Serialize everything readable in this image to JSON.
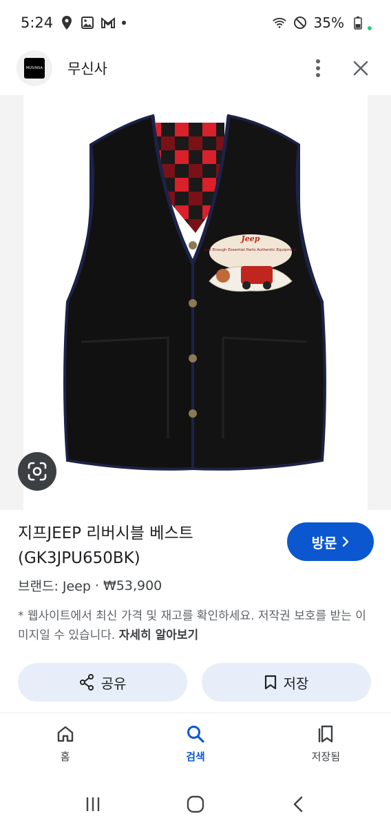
{
  "status_bar": {
    "time": "5:24",
    "battery": "35%",
    "icons": [
      "location-icon",
      "image-icon",
      "gmail-icon",
      "more-dot-icon",
      "wifi-icon",
      "do-not-disturb-icon",
      "battery-icon"
    ]
  },
  "app_bar": {
    "logo_text": "MUSINSA",
    "site_name": "무신사",
    "menu_icon": "more-vert-icon",
    "close_icon": "close-icon"
  },
  "product": {
    "title": "지프JEEP 리버시블 베스트 (GK3JPU650BK)",
    "brand_line": "브랜드: Jeep",
    "separator": "·",
    "price": "₩53,900",
    "visit_label": "방문",
    "visit_icon": "chevron-right-icon",
    "patch_text": "Jeep",
    "patch_sub": "Just Enough Essential Parts Authentic Equipment"
  },
  "disclaimer": {
    "text": "* 웹사이트에서 최신 가격 및 재고를 확인하세요. 저작권 보호를 받는 이미지일 수 있습니다. ",
    "learn_more": "자세히 알아보기"
  },
  "actions": {
    "share_label": "공유",
    "save_label": "저장"
  },
  "bottom_nav": {
    "items": [
      {
        "label": "홈",
        "icon": "home-icon"
      },
      {
        "label": "검색",
        "icon": "search-icon",
        "active": true
      },
      {
        "label": "저장됨",
        "icon": "saved-icon"
      }
    ]
  },
  "colors": {
    "accent": "#0b57d0",
    "chip_bg": "#e8eef9",
    "vest": "#111111",
    "plaid_red": "#d9202b"
  }
}
